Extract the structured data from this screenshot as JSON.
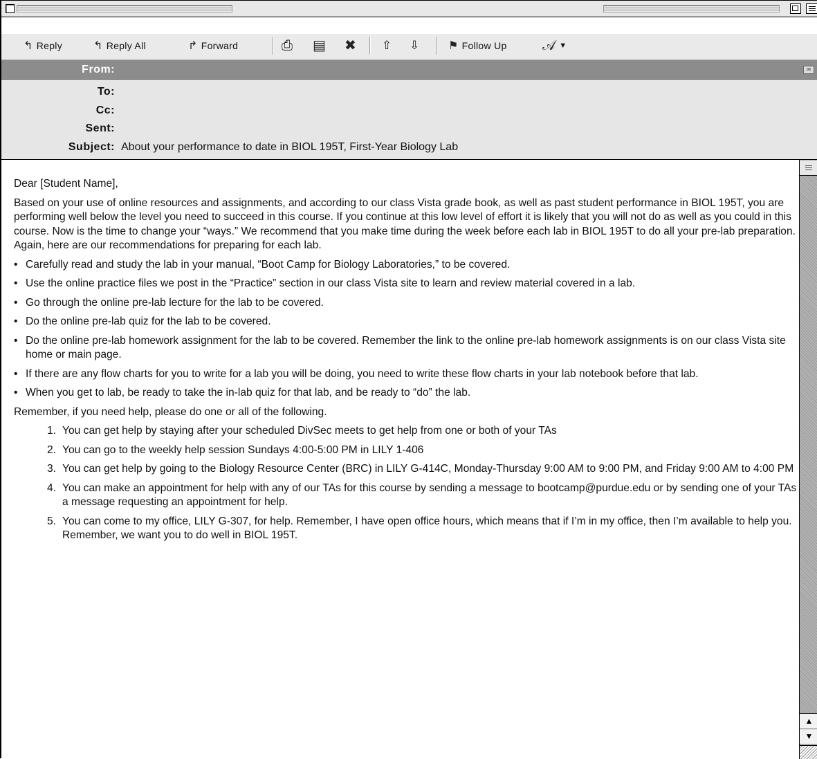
{
  "toolbar": {
    "reply": "Reply",
    "reply_all": "Reply All",
    "forward": "Forward",
    "follow_up": "Follow Up"
  },
  "header": {
    "from_label": "From:",
    "to_label": "To:",
    "cc_label": "Cc:",
    "sent_label": "Sent:",
    "subject_label": "Subject:",
    "subject": "About your performance to date in BIOL 195T, First-Year Biology Lab"
  },
  "body": {
    "greeting": "Dear [Student Name],",
    "intro": "Based on your use of online resources and assignments, and according to our class Vista grade book, as well as past student performance in BIOL 195T, you are performing well below the level you need to succeed in this course. If you continue at this low level of effort it is likely that you will not do as well as you could in this course. Now is the time to change your “ways.” We recommend that you make time during the week before each lab in BIOL 195T to do all your pre-lab preparation. Again, here are our recommendations for preparing for each lab.",
    "bullets": [
      "Carefully read and study the lab in your manual, “Boot Camp for Biology Laboratories,” to be covered.",
      "Use the online practice files we post in the “Practice” section in our class Vista site to learn and review material covered in a lab.",
      "Go through the online pre-lab lecture for the lab to be covered.",
      "Do the online pre-lab quiz for the lab to be covered.",
      "Do the online pre-lab homework assignment for the lab to be covered. Remember the link to the online pre-lab homework assignments is on our class Vista site home or main page.",
      "If there are any flow charts for you to write for a lab you will be doing, you need to write these flow charts in your lab notebook before that lab.",
      "When you get to lab, be ready to take the in-lab quiz for that lab, and be ready to “do” the lab."
    ],
    "help_intro": "Remember, if you need help, please do one or all of the following.",
    "help_items": [
      "You can get help by staying after your scheduled DivSec meets to get help from one or both of your TAs",
      "You can go to the weekly help session Sundays 4:00-5:00 PM in LILY 1-406",
      "You can get help by going to the Biology Resource Center (BRC) in LILY G-414C, Monday-Thursday 9:00 AM to 9:00 PM, and Friday 9:00 AM to 4:00 PM",
      "You can make an appointment for help with any of our TAs for this course by sending a message to bootcamp@purdue.edu or by sending one of your TAs a message requesting an appointment for help.",
      "You can come to my office, LILY G-307, for help. Remember, I have open office hours, which means that if I’m in my office, then I’m available to help you. Remember, we want you to do well in BIOL 195T."
    ]
  }
}
